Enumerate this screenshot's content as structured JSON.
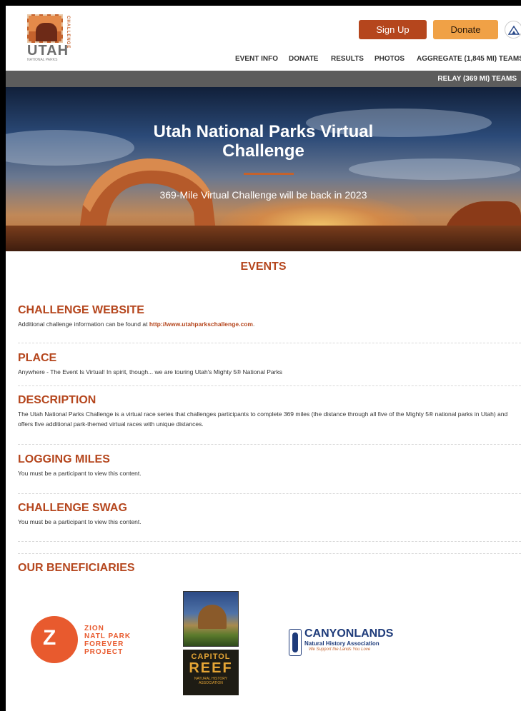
{
  "header": {
    "logo": {
      "main": "UTAH",
      "vertical": "CHALLENGE",
      "small": "NATIONAL PARKS"
    },
    "signup_label": "Sign Up",
    "donate_label": "Donate",
    "nav": [
      "EVENT INFO",
      "DONATE",
      "RESULTS",
      "PHOTOS",
      "AGGREGATE (1,845 MI) TEAMS"
    ],
    "subnav": "RELAY (369 MI) TEAMS"
  },
  "hero": {
    "title": "Utah National Parks Virtual Challenge",
    "subtitle": "369-Mile Virtual Challenge will be back in 2023"
  },
  "events": {
    "title": "EVENTS",
    "sections": [
      {
        "heading": "CHALLENGE WEBSITE",
        "text": "Additional challenge information can be found at ",
        "link": "http://www.utahparkschallenge.com",
        "after": "."
      },
      {
        "heading": "PLACE",
        "text": "Anywhere - The Event Is Virtual! In spirit, though... we are touring Utah's Mighty 5® National Parks"
      },
      {
        "heading": "DESCRIPTION",
        "text": "The Utah National Parks Challenge is a virtual race series that challenges participants to complete 369 miles (the distance through all five of the Mighty 5® national parks in Utah) and offers five additional park-themed virtual races with unique distances."
      },
      {
        "heading": "LOGGING MILES",
        "text": "You must be a participant to view this content."
      },
      {
        "heading": "CHALLENGE SWAG",
        "text": "You must be a participant to view this content."
      }
    ]
  },
  "beneficiaries": {
    "title": "OUR BENEFICIARIES",
    "zion": {
      "line1": "ZION",
      "line2": "NATL PARK",
      "line3": "FOREVER",
      "line4": "PROJECT"
    },
    "capitol": {
      "line1": "CAPITOL",
      "line2": "REEF",
      "line3": "NATURAL HISTORY ASSOCIATION"
    },
    "canyonlands": {
      "name": "CANYONLANDS",
      "sub": "Natural History Association",
      "tagline": "We Support the Lands You Love"
    }
  },
  "colors": {
    "accent": "#b5461d",
    "donate": "#f0a146",
    "subbar": "#5c5c5c"
  }
}
